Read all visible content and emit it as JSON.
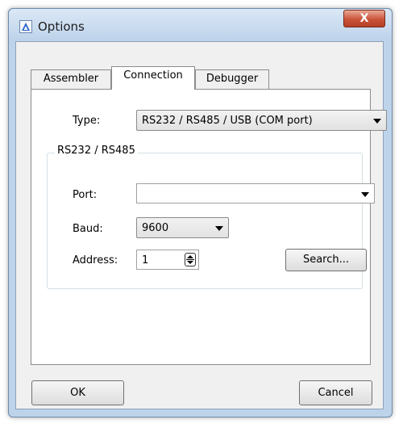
{
  "window": {
    "title": "Options",
    "close_label": "X"
  },
  "tabs": [
    {
      "label": "Assembler",
      "active": false
    },
    {
      "label": "Connection",
      "active": true
    },
    {
      "label": "Debugger",
      "active": false
    }
  ],
  "connection": {
    "type_label": "Type:",
    "type_value": "RS232 / RS485 / USB (COM port)",
    "group_label": "RS232 / RS485",
    "port_label": "Port:",
    "port_value": "",
    "baud_label": "Baud:",
    "baud_value": "9600",
    "address_label": "Address:",
    "address_value": "1",
    "search_label": "Search..."
  },
  "footer": {
    "ok_label": "OK",
    "cancel_label": "Cancel"
  },
  "icons": {
    "app": "options-app-icon",
    "close": "close-icon",
    "dropdown": "chevron-down-icon",
    "spinner": "up-down-spinner-icon"
  }
}
